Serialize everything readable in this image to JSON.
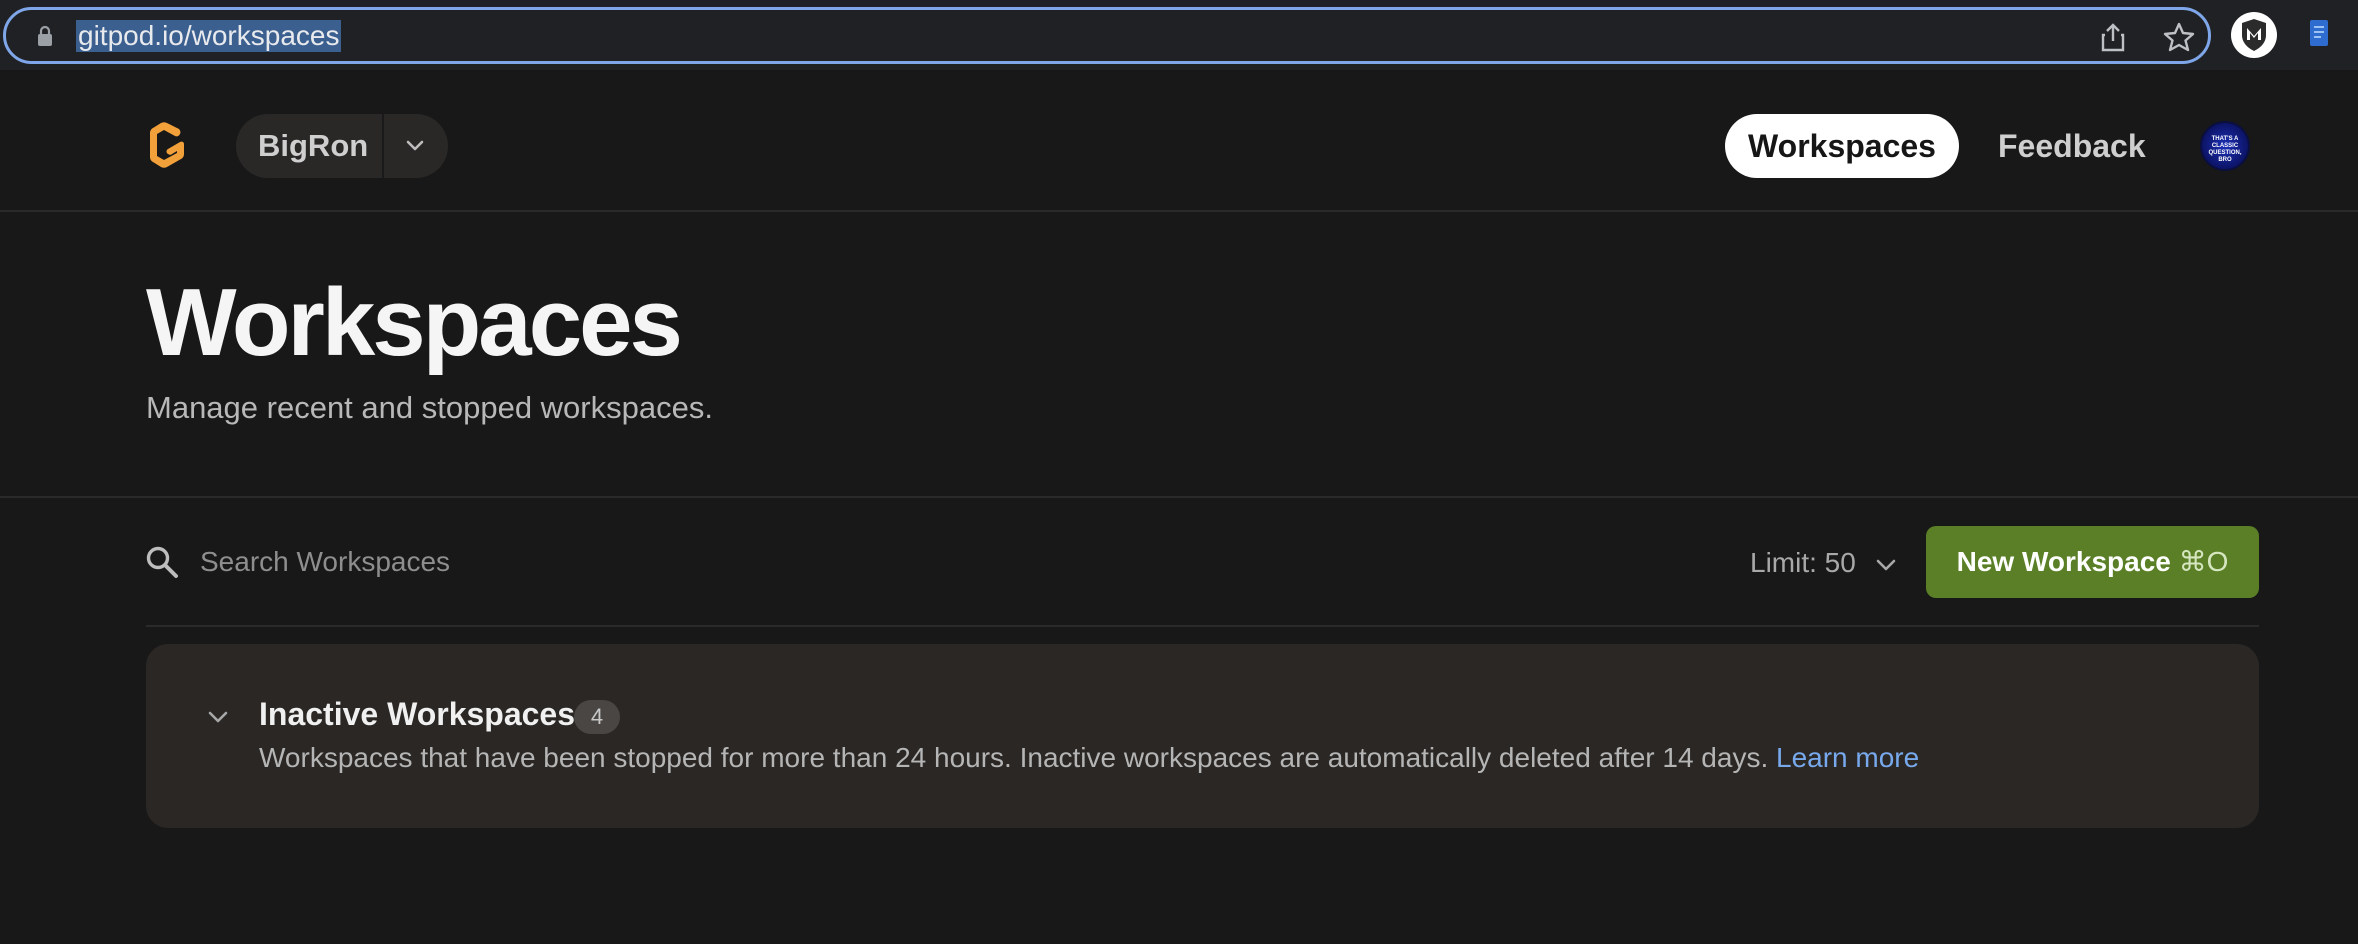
{
  "browser": {
    "url": "gitpod.io/workspaces"
  },
  "header": {
    "org_name": "BigRon",
    "nav": {
      "workspaces_label": "Workspaces",
      "feedback_label": "Feedback"
    },
    "avatar_text": "THAT'S A CLASSIC QUESTION, BRO"
  },
  "hero": {
    "title": "Workspaces",
    "subtitle": "Manage recent and stopped workspaces."
  },
  "toolbar": {
    "search_placeholder": "Search Workspaces",
    "limit_label": "Limit: 50",
    "new_workspace_label": "New Workspace ",
    "new_workspace_shortcut": "⌘O"
  },
  "inactive_section": {
    "title": "Inactive Workspaces",
    "count": "4",
    "description": "Workspaces that have been stopped for more than 24 hours. Inactive workspaces are automatically deleted after 14 days. ",
    "learn_more_label": "Learn more"
  },
  "colors": {
    "background": "#181818",
    "accent_green": "#5b7f26",
    "link_blue": "#78a9ec",
    "logo_orange": "#f2a03a"
  },
  "icons": [
    "lock-icon",
    "share-icon",
    "star-icon",
    "extension-shield-icon",
    "extension-icon",
    "gitpod-logo-icon",
    "chevron-down-icon",
    "search-icon"
  ]
}
